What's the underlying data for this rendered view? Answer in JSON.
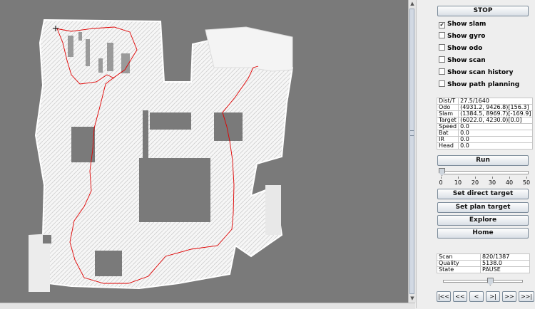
{
  "controls": {
    "stop_label": "STOP",
    "run_label": "Run",
    "set_direct_target_label": "Set direct target",
    "set_plan_target_label": "Set plan target",
    "explore_label": "Explore",
    "home_label": "Home"
  },
  "checkboxes": [
    {
      "label": "Show slam",
      "checked": true
    },
    {
      "label": "Show gyro",
      "checked": false
    },
    {
      "label": "Show odo",
      "checked": false
    },
    {
      "label": "Show scan",
      "checked": false
    },
    {
      "label": "Show scan history",
      "checked": false
    },
    {
      "label": "Show path planning",
      "checked": false
    }
  ],
  "status": [
    {
      "key": "Dist/T",
      "value": "27.5/1640"
    },
    {
      "key": "Odo",
      "value": "(4931.2, 9426.8)[156.3]"
    },
    {
      "key": "Slam",
      "value": "(1384.5, 8969.7)[-169.9]"
    },
    {
      "key": "Target",
      "value": "(6022.0, 4230.0)[0.0]"
    },
    {
      "key": "Speed",
      "value": "0.0"
    },
    {
      "key": "Bat",
      "value": "0.0"
    },
    {
      "key": "IR",
      "value": "0.0"
    },
    {
      "key": "Head",
      "value": "0.0"
    }
  ],
  "speed_slider": {
    "value": 0,
    "ticks": [
      "0",
      "10",
      "20",
      "30",
      "40",
      "50"
    ]
  },
  "scan_info": [
    {
      "key": "Scan",
      "value": "820/1387"
    },
    {
      "key": "Quality",
      "value": "5138.0"
    },
    {
      "key": "State",
      "value": "PAUSE"
    }
  ],
  "playback_slider": {
    "fraction": 0.6
  },
  "playback": {
    "first": "|<<",
    "back": "<<",
    "prev": "<",
    "next": ">|",
    "forward": ">>",
    "last": ">>|"
  },
  "colors": {
    "map_background": "#7a7a7a",
    "free_space": "#ffffff",
    "path": "#e00000"
  }
}
